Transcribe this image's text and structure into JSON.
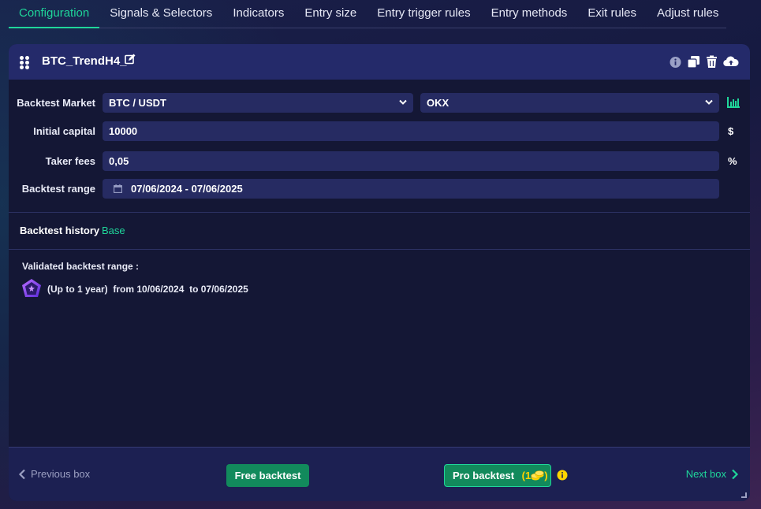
{
  "tabs": [
    {
      "label": "Configuration",
      "active": true
    },
    {
      "label": "Signals & Selectors",
      "active": false
    },
    {
      "label": "Indicators",
      "active": false
    },
    {
      "label": "Entry size",
      "active": false
    },
    {
      "label": "Entry trigger rules",
      "active": false
    },
    {
      "label": "Entry methods",
      "active": false
    },
    {
      "label": "Exit rules",
      "active": false
    },
    {
      "label": "Adjust rules",
      "active": false
    }
  ],
  "card": {
    "title": "BTC_TrendH4_",
    "header_icons": [
      "info-icon",
      "duplicate-icon",
      "trash-icon",
      "cloud-upload-icon"
    ]
  },
  "form": {
    "market_label": "Backtest Market",
    "market_pair": "BTC / USDT",
    "exchange": "OKX",
    "capital_label": "Initial capital",
    "capital_value": "10000",
    "capital_unit": "$",
    "fees_label": "Taker fees",
    "fees_value": "0,05",
    "fees_unit": "%",
    "range_label": "Backtest range",
    "range_value": "07/06/2024 - 07/06/2025"
  },
  "history": {
    "label": "Backtest history",
    "value": "Base"
  },
  "validated": {
    "label": "Validated backtest range :",
    "text": "(Up to 1 year)  from 10/06/2024  to 07/06/2025"
  },
  "footer": {
    "previous": "Previous box",
    "free_button": "Free backtest",
    "pro_button": "Pro backtest",
    "pro_cost_open": "(1",
    "pro_cost_close": ")",
    "next": "Next box"
  },
  "colors": {
    "accent": "#1fd69a",
    "button": "#128a5c",
    "header": "#242a6a",
    "coin": "#ffd400"
  }
}
